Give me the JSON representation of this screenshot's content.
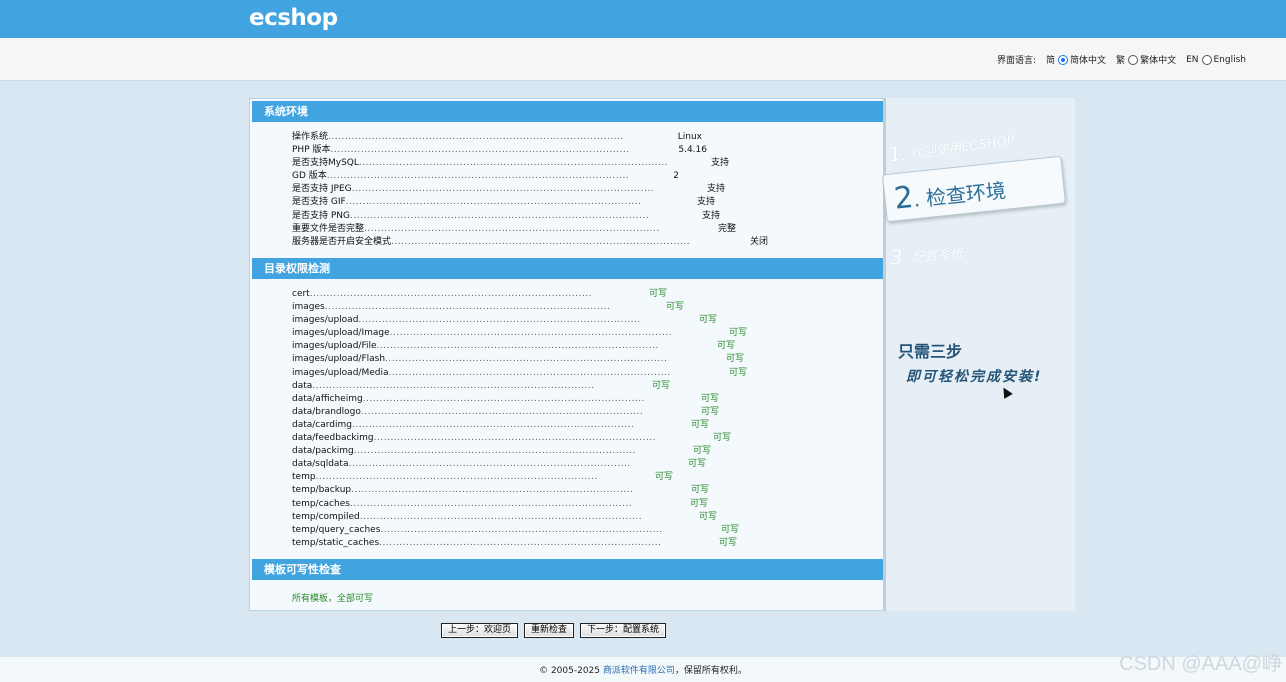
{
  "header": {
    "logo": "ecshop"
  },
  "language": {
    "label": "界面语言:",
    "options": [
      {
        "prefix": "简",
        "label": "简体中文",
        "selected": true
      },
      {
        "prefix": "繁",
        "label": "繁体中文",
        "selected": false
      },
      {
        "prefix": "EN",
        "label": "English",
        "selected": false
      }
    ]
  },
  "system_env": {
    "title": "系统环境",
    "rows": [
      {
        "label": "操作系统",
        "value": "Linux"
      },
      {
        "label": "PHP 版本",
        "value": "5.4.16"
      },
      {
        "label": "是否支持MySQL",
        "value": "支持"
      },
      {
        "label": "GD 版本",
        "value": "2"
      },
      {
        "label": "是否支持 JPEG",
        "value": "支持"
      },
      {
        "label": "是否支持 GIF",
        "value": "支持"
      },
      {
        "label": "是否支持 PNG",
        "value": "支持"
      },
      {
        "label": "重要文件是否完整",
        "value": "完整"
      },
      {
        "label": "服务器是否开启安全模式",
        "value": "关闭"
      }
    ]
  },
  "dir_perms": {
    "title": "目录权限检测",
    "rows": [
      {
        "label": "cert",
        "value": "可写"
      },
      {
        "label": "images",
        "value": "可写"
      },
      {
        "label": "images/upload",
        "value": "可写"
      },
      {
        "label": "images/upload/Image",
        "value": "可写"
      },
      {
        "label": "images/upload/File",
        "value": "可写"
      },
      {
        "label": "images/upload/Flash",
        "value": "可写"
      },
      {
        "label": "images/upload/Media",
        "value": "可写"
      },
      {
        "label": "data",
        "value": "可写"
      },
      {
        "label": "data/afficheimg",
        "value": "可写"
      },
      {
        "label": "data/brandlogo",
        "value": "可写"
      },
      {
        "label": "data/cardimg",
        "value": "可写"
      },
      {
        "label": "data/feedbackimg",
        "value": "可写"
      },
      {
        "label": "data/packimg",
        "value": "可写"
      },
      {
        "label": "data/sqldata",
        "value": "可写"
      },
      {
        "label": "temp",
        "value": "可写"
      },
      {
        "label": "temp/backup",
        "value": "可写"
      },
      {
        "label": "temp/caches",
        "value": "可写"
      },
      {
        "label": "temp/compiled",
        "value": "可写"
      },
      {
        "label": "temp/query_caches",
        "value": "可写"
      },
      {
        "label": "temp/static_caches",
        "value": "可写"
      }
    ]
  },
  "template_check": {
    "title": "模板可写性检查",
    "result": "所有模板，全部可写"
  },
  "sidebar": {
    "step1": {
      "num": "1",
      "text": ". 欢迎使用ECSHOP"
    },
    "step2": {
      "num": "2",
      "text": ". 检查环境"
    },
    "step3": {
      "num": "3",
      "text": ". 配置系统"
    },
    "slogan1": "只需三步",
    "slogan2": "即可轻松完成安装!"
  },
  "buttons": {
    "prev": "上一步：欢迎页",
    "recheck": "重新检查",
    "next": "下一步：配置系统"
  },
  "footer": {
    "copyright": "© 2005-2025 ",
    "company": "商派软件有限公司",
    "rights": "，保留所有权利。"
  },
  "watermark": "CSDN @AAA@峥",
  "colors": {
    "header_blue": "#41a4e1",
    "ok_green": "#2a8a2a"
  }
}
